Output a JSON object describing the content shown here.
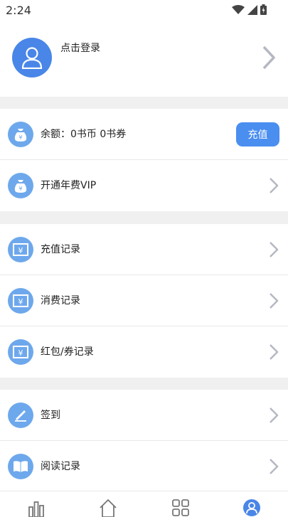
{
  "status_bar": {
    "time": "2:24",
    "icons": [
      "wifi-icon",
      "signal-icon",
      "battery-icon"
    ]
  },
  "profile": {
    "login_text": "点击登录",
    "avatar_icon": "user-icon"
  },
  "balance": {
    "label": "余额：0书币  0书券",
    "topup_label": "充值",
    "icon": "moneybag-icon"
  },
  "vip": {
    "label": "开通年费VIP",
    "icon": "moneybag-icon"
  },
  "records": [
    {
      "label": "充值记录",
      "icon": "receipt-icon"
    },
    {
      "label": "消费记录",
      "icon": "receipt-icon"
    },
    {
      "label": "红包/券记录",
      "icon": "receipt-icon"
    }
  ],
  "others": [
    {
      "label": "签到",
      "icon": "pen-icon"
    },
    {
      "label": "阅读记录",
      "icon": "book-icon"
    }
  ],
  "tabbar": {
    "icons": [
      "chart-icon",
      "home-icon",
      "grid-icon",
      "profile-icon"
    ],
    "active_index": 3
  },
  "colors": {
    "accent": "#4a8ef0",
    "icon_bg": "#6ea8ec",
    "section_gap": "#f0f0f0"
  }
}
